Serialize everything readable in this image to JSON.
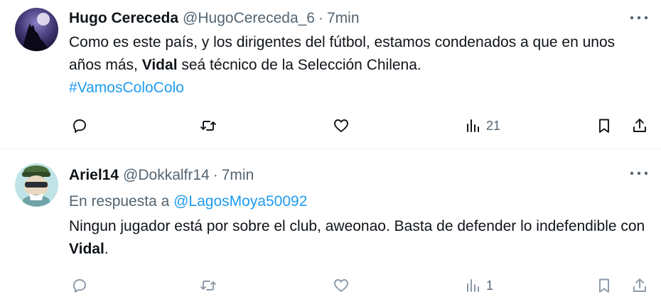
{
  "tweets": [
    {
      "display_name": "Hugo Cereceda",
      "handle": "@HugoCereceda_6",
      "separator": "·",
      "time": "7min",
      "body_parts": [
        "Como es este país, y los dirigentes del fútbol, estamos condenados a que en unos años más, ",
        "Vidal",
        " seá técnico de la Selección Chilena."
      ],
      "hashtag": "#VamosColoColo",
      "views": "21"
    },
    {
      "display_name": "Ariel14",
      "handle": "@Dokkalfr14",
      "separator": "·",
      "time": "7min",
      "reply_label": "En respuesta a",
      "reply_mention": "@LagosMoya50092",
      "body_parts": [
        "Ningun jugador está por sobre el club, aweonao. Basta de defender lo indefendible con ",
        "Vidal",
        "."
      ],
      "views": "1"
    }
  ],
  "icons": {
    "more": "more-horizontal-icon",
    "reply": "reply-icon",
    "retweet": "retweet-icon",
    "like": "heart-icon",
    "views": "views-chart-icon",
    "bookmark": "bookmark-icon",
    "share": "share-icon"
  },
  "colors": {
    "text": "#0f1419",
    "secondary": "#536471",
    "link": "#1d9bf0",
    "divider": "#eff3f4"
  }
}
